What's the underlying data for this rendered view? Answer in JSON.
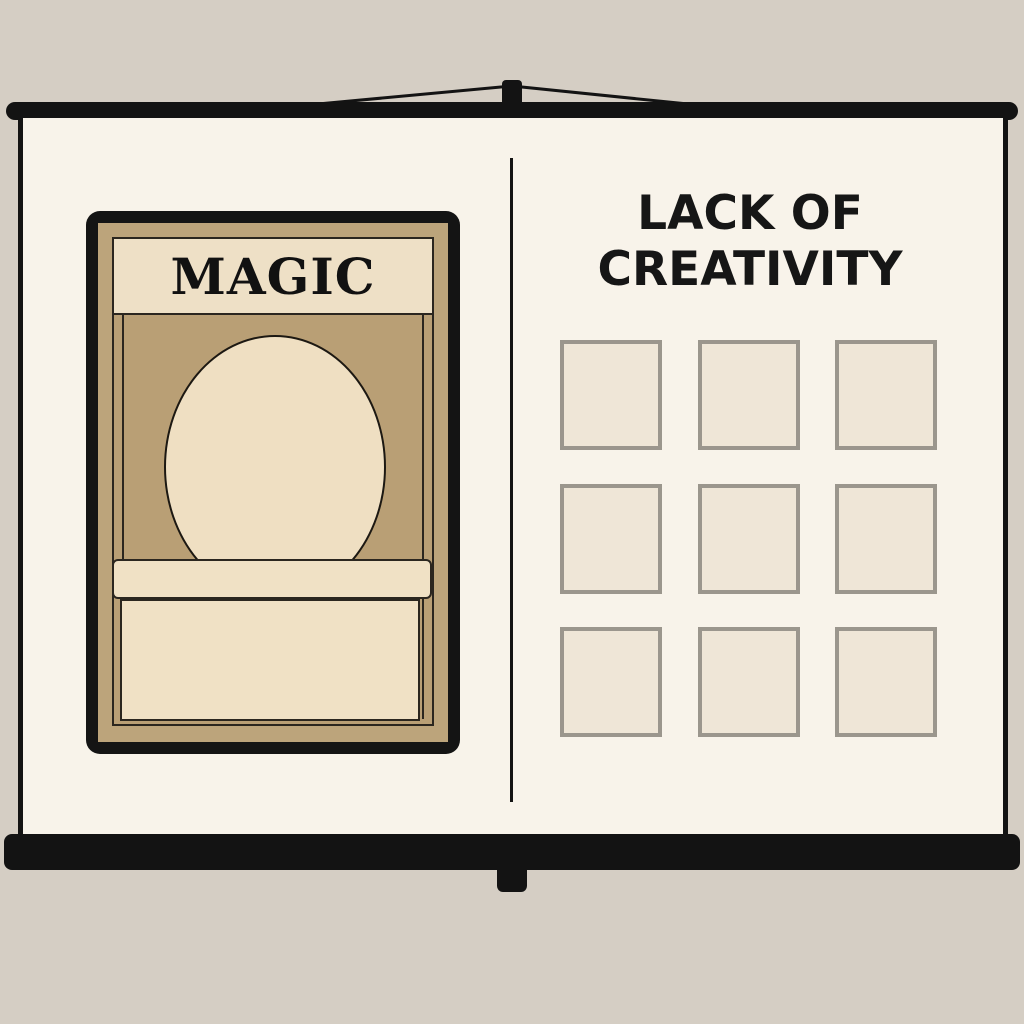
{
  "card": {
    "title": "MAGIC"
  },
  "panel": {
    "heading_line1": "LACK OF",
    "heading_line2": "CREATIVITY",
    "tiles": [
      {
        "row": 1,
        "col": 1
      },
      {
        "row": 1,
        "col": 2
      },
      {
        "row": 1,
        "col": 3
      },
      {
        "row": 2,
        "col": 1
      },
      {
        "row": 2,
        "col": 2
      },
      {
        "row": 2,
        "col": 3
      },
      {
        "row": 3,
        "col": 1
      },
      {
        "row": 3,
        "col": 2
      },
      {
        "row": 3,
        "col": 3
      }
    ]
  },
  "colors": {
    "background": "#d5cec4",
    "screen": "#f8f3ea",
    "frame": "#131313",
    "card_border": "#bca47b",
    "card_panel": "#f0e1c5",
    "tile_fill": "#efe6d7",
    "tile_border": "#9b968d"
  }
}
